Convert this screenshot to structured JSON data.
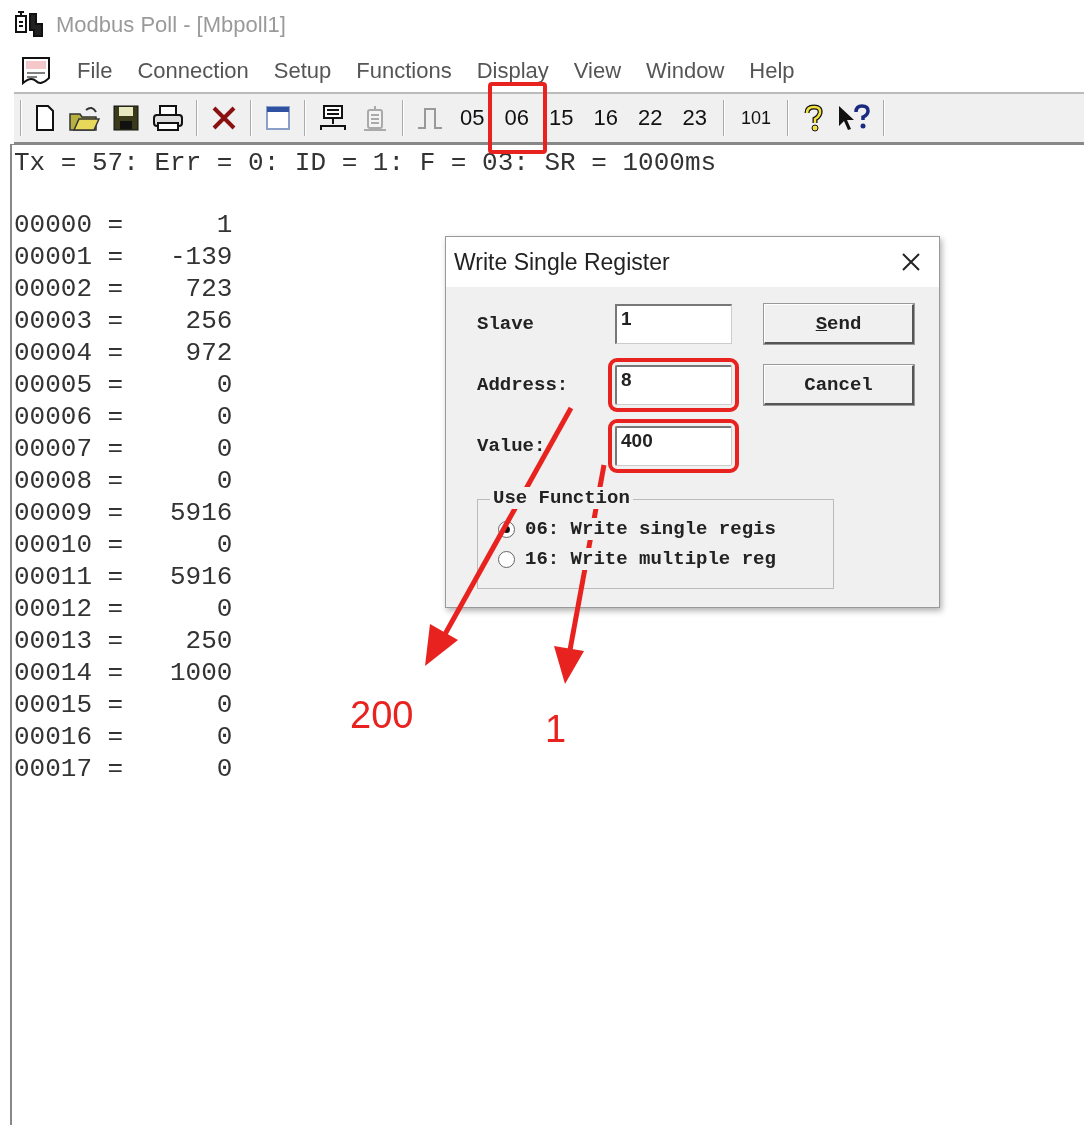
{
  "window": {
    "title": "Modbus Poll - [Mbpoll1]"
  },
  "menu": [
    "File",
    "Connection",
    "Setup",
    "Functions",
    "Display",
    "View",
    "Window",
    "Help"
  ],
  "toolbar": {
    "function_codes": [
      {
        "label": "05",
        "annotated": false
      },
      {
        "label": "06",
        "annotated": true
      },
      {
        "label": "15",
        "annotated": false
      },
      {
        "label": "16",
        "annotated": false
      },
      {
        "label": "22",
        "annotated": false
      },
      {
        "label": "23",
        "annotated": false
      }
    ],
    "address_button": "101"
  },
  "status": "Tx = 57: Err = 0: ID = 1: F = 03: SR = 1000ms",
  "registers": [
    {
      "address": "00000 =",
      "value": "1"
    },
    {
      "address": "00001 =",
      "value": "-139"
    },
    {
      "address": "00002 =",
      "value": "723"
    },
    {
      "address": "00003 =",
      "value": "256"
    },
    {
      "address": "00004 =",
      "value": "972"
    },
    {
      "address": "00005 =",
      "value": "0"
    },
    {
      "address": "00006 =",
      "value": "0"
    },
    {
      "address": "00007 =",
      "value": "0"
    },
    {
      "address": "00008 =",
      "value": "0"
    },
    {
      "address": "00009 =",
      "value": "5916"
    },
    {
      "address": "00010 =",
      "value": "0"
    },
    {
      "address": "00011 =",
      "value": "5916"
    },
    {
      "address": "00012 =",
      "value": "0"
    },
    {
      "address": "00013 =",
      "value": "250"
    },
    {
      "address": "00014 =",
      "value": "1000"
    },
    {
      "address": "00015 =",
      "value": "0"
    },
    {
      "address": "00016 =",
      "value": "0"
    },
    {
      "address": "00017 =",
      "value": "0"
    }
  ],
  "dialog": {
    "title": "Write Single Register",
    "fields": [
      {
        "label": "Slave",
        "value": "1",
        "annotated": false
      },
      {
        "label": "Address:",
        "value": "8",
        "annotated": true
      },
      {
        "label": "Value:",
        "value": "400",
        "annotated": true
      }
    ],
    "buttons": [
      {
        "label": "Send",
        "first_letter_underlined": true
      },
      {
        "label": "Cancel"
      }
    ],
    "function_group": {
      "title": "Use Function",
      "options": [
        {
          "label": "06: Write single regis",
          "selected": true
        },
        {
          "label": "16: Write multiple reg",
          "selected": false
        }
      ]
    }
  },
  "annotations": [
    {
      "label": "200"
    },
    {
      "label": "1"
    }
  ]
}
